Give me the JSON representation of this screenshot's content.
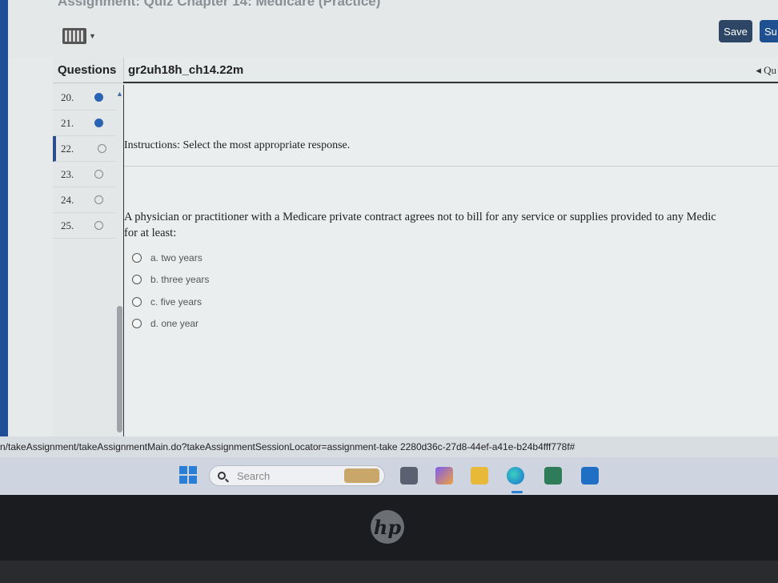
{
  "app": {
    "title": "Assignment: Quiz Chapter 14: Medicare (Practice)"
  },
  "toolbar": {
    "save_label": "Save",
    "submit_label": "Su"
  },
  "questions_panel": {
    "header": "Questions",
    "items": [
      {
        "number": "20.",
        "status": "answered"
      },
      {
        "number": "21.",
        "status": "answered"
      },
      {
        "number": "22.",
        "status": "unanswered",
        "current": true
      },
      {
        "number": "23.",
        "status": "unanswered"
      },
      {
        "number": "24.",
        "status": "unanswered"
      },
      {
        "number": "25.",
        "status": "unanswered"
      }
    ]
  },
  "question": {
    "id": "gr2uh18h_ch14.22m",
    "nav_prev": "◂ Qu",
    "instructions": "Instructions: Select the most appropriate response.",
    "text_line1": "A physician or practitioner with a Medicare private contract agrees not to bill for any service or supplies provided to any Medic",
    "text_line2": "for at least:",
    "choices": [
      {
        "label": "a. two years"
      },
      {
        "label": "b. three years"
      },
      {
        "label": "c. five years"
      },
      {
        "label": "d. one year"
      }
    ]
  },
  "status_url": "n/takeAssignment/takeAssignmentMain.do?takeAssignmentSessionLocator=assignment-take 2280d36c-27d8-44ef-a41e-b24b4fff778f#",
  "taskbar": {
    "search_label": "Search"
  },
  "colors": {
    "accent": "#2b63b3",
    "save_button": "#2d4666",
    "submit_button": "#1d4f91"
  }
}
